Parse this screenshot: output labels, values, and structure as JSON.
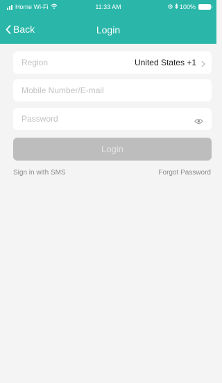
{
  "status_bar": {
    "network": "Home Wi-Fi",
    "time": "11:33 AM",
    "battery": "100%"
  },
  "nav": {
    "back_label": "Back",
    "title": "Login"
  },
  "form": {
    "region_label": "Region",
    "region_value": "United States +1",
    "mobile_placeholder": "Mobile Number/E-mail",
    "password_placeholder": "Password",
    "login_label": "Login"
  },
  "links": {
    "sms": "Sign in with SMS",
    "forgot": "Forgot Password"
  },
  "colors": {
    "accent": "#2ab7a9",
    "background": "#f4f4f4",
    "button_disabled": "#bdbdbd"
  }
}
